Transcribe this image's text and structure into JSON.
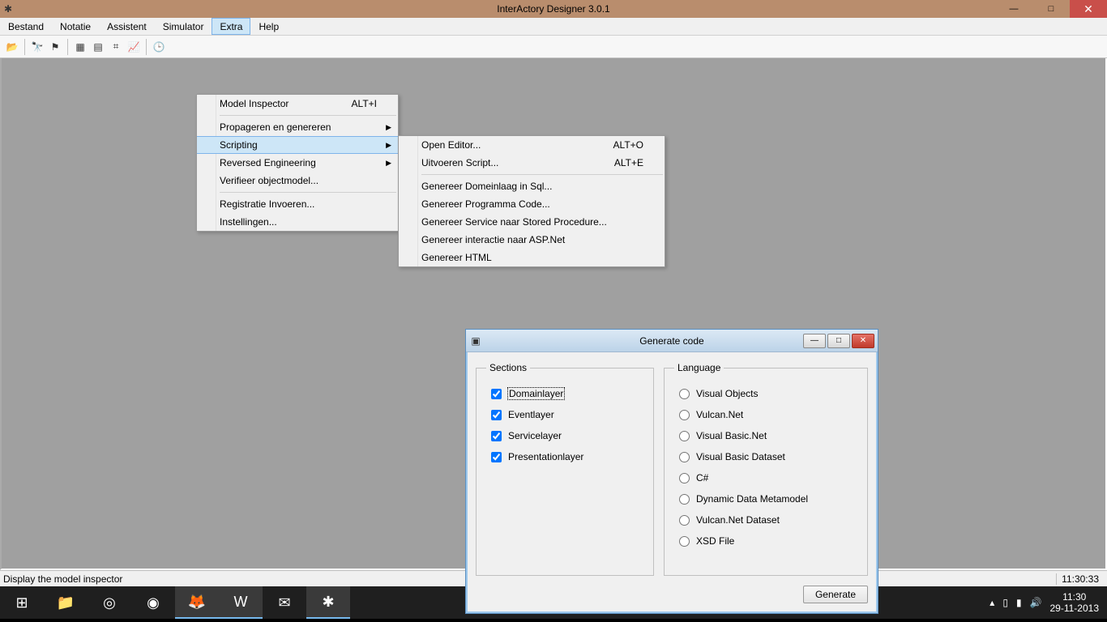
{
  "titlebar": {
    "title": "InterActory Designer 3.0.1"
  },
  "menubar": {
    "items": [
      "Bestand",
      "Notatie",
      "Assistent",
      "Simulator",
      "Extra",
      "Help"
    ],
    "active_index": 4
  },
  "menu_extra": {
    "items": [
      {
        "label": "Model Inspector",
        "shortcut": "ALT+I"
      },
      {
        "divider": true
      },
      {
        "label": "Propageren en genereren",
        "submenu": true
      },
      {
        "label": "Scripting",
        "submenu": true,
        "highlight": true
      },
      {
        "label": "Reversed Engineering",
        "submenu": true
      },
      {
        "label": "Verifieer objectmodel..."
      },
      {
        "divider": true
      },
      {
        "label": "Registratie Invoeren..."
      },
      {
        "label": "Instellingen..."
      }
    ]
  },
  "menu_scripting": {
    "items": [
      {
        "label": "Open Editor...",
        "shortcut": "ALT+O"
      },
      {
        "label": "Uitvoeren Script...",
        "shortcut": "ALT+E"
      },
      {
        "divider": true
      },
      {
        "label": "Genereer Domeinlaag in Sql..."
      },
      {
        "label": "Genereer Programma Code..."
      },
      {
        "label": "Genereer Service naar Stored Procedure..."
      },
      {
        "label": "Genereer interactie naar ASP.Net"
      },
      {
        "label": "Genereer HTML"
      }
    ]
  },
  "dialog": {
    "title": "Generate code",
    "sections_legend": "Sections",
    "language_legend": "Language",
    "sections": [
      {
        "label": "Domainlayer",
        "checked": true,
        "focused": true
      },
      {
        "label": "Eventlayer",
        "checked": true
      },
      {
        "label": "Servicelayer",
        "checked": true
      },
      {
        "label": "Presentationlayer",
        "checked": true
      }
    ],
    "languages": [
      {
        "label": "Visual Objects"
      },
      {
        "label": "Vulcan.Net"
      },
      {
        "label": "Visual Basic.Net"
      },
      {
        "label": "Visual Basic Dataset"
      },
      {
        "label": "C#"
      },
      {
        "label": "Dynamic Data Metamodel"
      },
      {
        "label": "Vulcan.Net Dataset"
      },
      {
        "label": "XSD File"
      }
    ],
    "generate_label": "Generate"
  },
  "statusbar": {
    "left": "Display the model inspector",
    "right": "11:30:33"
  },
  "taskbar": {
    "tray_time": "11:30",
    "tray_date": "29-11-2013"
  }
}
